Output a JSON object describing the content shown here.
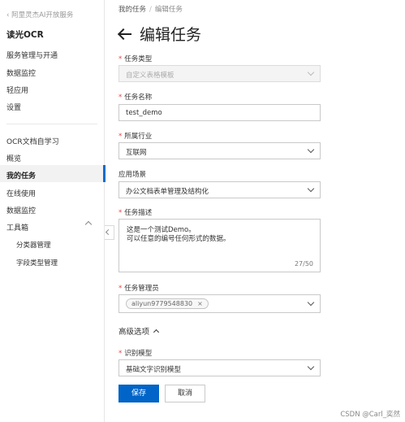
{
  "sidebar": {
    "back_link": "阿里灵杰AI开放服务",
    "product_title": "读光OCR",
    "items_top": [
      "服务管理与开通",
      "数据监控",
      "轻应用",
      "设置"
    ],
    "section_title": "OCR文档自学习",
    "items_section": [
      "概览",
      "我的任务",
      "在线使用",
      "数据监控",
      "工具箱"
    ],
    "active_item": "我的任务",
    "toolbox_children": [
      "分类器管理",
      "字段类型管理"
    ]
  },
  "breadcrumb": {
    "parent": "我的任务",
    "separator": "/",
    "current": "编辑任务"
  },
  "page_title": "编辑任务",
  "form": {
    "task_type": {
      "label": "任务类型",
      "value": "自定义表格模板"
    },
    "task_name": {
      "label": "任务名称",
      "value": "test_demo"
    },
    "industry": {
      "label": "所属行业",
      "value": "互联网"
    },
    "scenario": {
      "label": "应用场景",
      "value": "办公文档表单管理及结构化"
    },
    "description": {
      "label": "任务描述",
      "line1": "这是一个测试Demo。",
      "line2": "可以任意的编号任何形式的数据。",
      "counter": "27/50"
    },
    "manager": {
      "label": "任务管理员",
      "tag": "aliyun9779548830",
      "tag_remove": "×"
    },
    "advanced": "高级选项",
    "model": {
      "label": "识别模型",
      "value": "基础文字识别模型"
    }
  },
  "buttons": {
    "save": "保存",
    "cancel": "取消"
  },
  "watermark": "CSDN @Carl_奕然",
  "colors": {
    "primary": "#0064c8",
    "required": "#e54545",
    "active_bar": "#0070cc"
  }
}
